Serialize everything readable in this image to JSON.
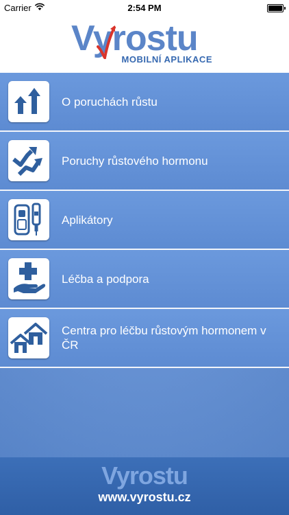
{
  "status_bar": {
    "carrier": "Carrier",
    "time": "2:54 PM"
  },
  "header": {
    "logo_text": "Vyrostu",
    "logo_subtitle": "MOBILNÍ APLIKACE"
  },
  "menu": {
    "items": [
      {
        "label": "O poruchách růstu",
        "icon": "growth-arrows-icon"
      },
      {
        "label": "Poruchy růstového hormonu",
        "icon": "zigzag-arrows-icon"
      },
      {
        "label": "Aplikátory",
        "icon": "injector-devices-icon"
      },
      {
        "label": "Léčba a podpora",
        "icon": "hand-cross-icon"
      },
      {
        "label": "Centra pro léčbu růstovým hormonem v ČR",
        "icon": "houses-icon"
      }
    ]
  },
  "footer": {
    "logo_text": "Vyrostu",
    "url": "www.vyrostu.cz"
  },
  "colors": {
    "brand_blue": "#5b85c8",
    "menu_blue": "#6a97dc",
    "footer_blue": "#3568b0",
    "icon_blue": "#2f5f9e",
    "swoosh_red": "#d9342b"
  }
}
